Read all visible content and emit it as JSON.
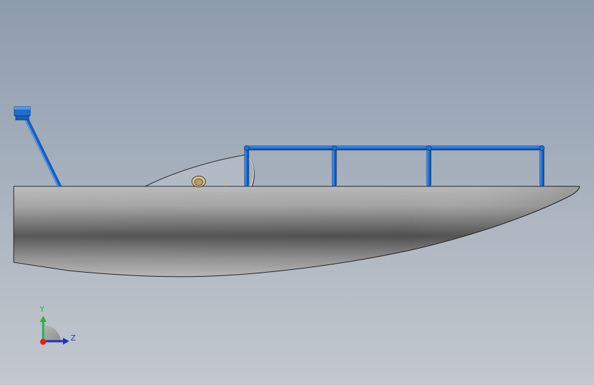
{
  "viewport": {
    "background_top": "#8d9cad",
    "background_bottom": "#c3c8ce"
  },
  "model": {
    "hull_color": "#8a8a8a",
    "frame_color": "#1f6fd1"
  },
  "triad": {
    "y_label": "Y",
    "z_label": "Z",
    "y_color": "#22b14c",
    "z_color": "#2030c8",
    "x_color": "#e02020"
  }
}
